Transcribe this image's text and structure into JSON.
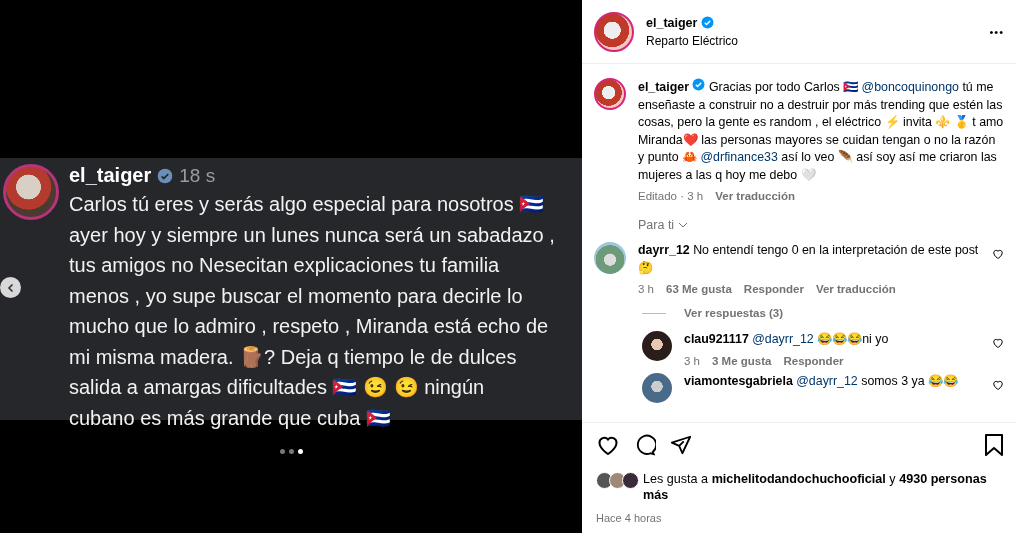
{
  "story": {
    "username": "el_taiger",
    "verified": true,
    "time": "18 s",
    "text": "Carlos tú eres y serás algo especial para nosotros 🇨🇺  ayer hoy y siempre un lunes nunca será un sabadazo , tus amigos no Nesecitan explicaciones tu familia menos , yo supe buscar el momento para decirle lo mucho que lo admiro , respeto , Miranda está echo de mi misma madera. 🪵? Deja q tiempo le de dulces salida a amargas dificultades 🇨🇺 😉 😉  ningún cubano es más grande que cuba 🇨🇺",
    "dots": [
      {
        "selected": false
      },
      {
        "selected": false
      },
      {
        "selected": true
      }
    ]
  },
  "post": {
    "header": {
      "username": "el_taiger",
      "verified": true,
      "location": "Reparto Eléctrico",
      "more": "•••"
    },
    "caption": {
      "username": "el_taiger",
      "verified": true,
      "segments": [
        {
          "kind": "text",
          "text": "Gracias por todo Carlos 🇨🇺 "
        },
        {
          "kind": "mention",
          "text": "@boncoquinongo"
        },
        {
          "kind": "text",
          "text": " tú me enseñaste a construir no a destruir por más trending que estén las cosas, pero la gente es random , el eléctrico ⚡ invita ⚜️ 🥇 t amo Miranda❤️ las personas mayores se cuidan tengan o no la razón y punto 🦀 "
        },
        {
          "kind": "mention",
          "text": "@drfinance33"
        },
        {
          "kind": "text",
          "text": " así lo veo 🪶  así soy así me criaron las mujeres a las q hoy me debo 🤍"
        }
      ],
      "time": "Editado · 3 h",
      "translate": "Ver traducción"
    },
    "sort": "Para ti",
    "comments": [
      {
        "username": "dayrr_12",
        "text": "No entendí tengo 0 en la interpretación de este post 🤔",
        "time": "3 h",
        "likes": "63 Me gusta",
        "reply": "Responder",
        "translate": "Ver traducción",
        "replies_link": "Ver respuestas (3)",
        "replies": [
          {
            "username": "clau921117",
            "mention": "@dayrr_12",
            "text": " 😂😂😂ni yo",
            "time": "3 h",
            "likes": "3 Me gusta",
            "reply": "Responder"
          },
          {
            "username": "viamontesgabriela",
            "mention": "@dayrr_12",
            "text": " somos 3 ya 😂😂"
          }
        ]
      }
    ],
    "likes": {
      "prefix": "Les gusta a ",
      "user": "michelitodandochuchooficial",
      "middle": " y ",
      "count": "4930 personas más"
    },
    "time": "Hace 4 horas"
  }
}
